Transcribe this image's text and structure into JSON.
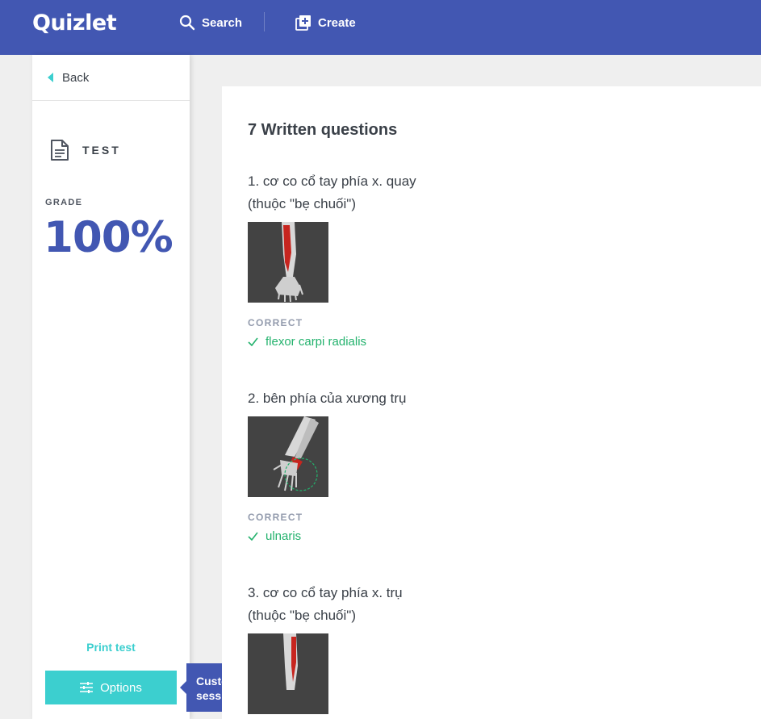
{
  "header": {
    "logo": "Quizlet",
    "search_label": "Search",
    "create_label": "Create"
  },
  "sidebar": {
    "back_label": "Back",
    "mode_label": "TEST",
    "grade_label": "GRADE",
    "grade_value": "100%",
    "print_label": "Print test",
    "options_label": "Options"
  },
  "tooltip": {
    "text": "Customize your study session"
  },
  "main": {
    "title": "7 Written questions",
    "questions": [
      {
        "prompt_line1": "1. cơ co cổ tay phía x. quay",
        "prompt_line2": "(thuộc \"bẹ chuối\")",
        "status": "CORRECT",
        "answer": "flexor carpi radialis"
      },
      {
        "prompt_line1": "2. bên phía của xương trụ",
        "status": "CORRECT",
        "answer": "ulnaris"
      },
      {
        "prompt_line1": "3. cơ co cổ tay phía x. trụ",
        "prompt_line2": "(thuộc \"bẹ chuối\")"
      }
    ]
  },
  "colors": {
    "brand_blue": "#4257b2",
    "accent_teal": "#3ccfcf",
    "correct_green": "#23b26d"
  }
}
